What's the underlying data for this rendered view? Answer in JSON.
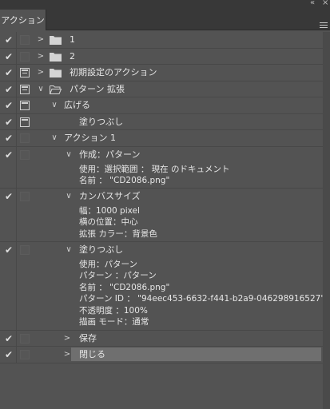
{
  "window": {
    "collapse_glyph": "«",
    "close_glyph": "×"
  },
  "panel": {
    "tab_label": "アクション"
  },
  "rows": [
    {
      "label": "1"
    },
    {
      "label": "2"
    },
    {
      "label": "初期設定のアクション"
    },
    {
      "label": "パターン 拡張"
    },
    {
      "label": "広げる"
    },
    {
      "label": "塗りつぶし"
    },
    {
      "label": "アクション 1"
    },
    {
      "label": "作成：パターン",
      "details": [
        "使用：選択範囲 ： 現在 のドキュメント",
        "名前 ： \"CD2086.png\""
      ]
    },
    {
      "label": "カンバスサイズ",
      "details": [
        "幅：1000 pixel",
        "横の位置：中心",
        "拡張 カラー：背景色"
      ]
    },
    {
      "label": "塗りつぶし",
      "details": [
        "使用：パターン",
        "パターン ：パターン",
        "名前 ： \"CD2086.png\"",
        "パターン ID ： \"94eec453-6632-f441-b2a9-046298916527\"",
        "不透明度 ：100%",
        "描画 モード：通常"
      ]
    },
    {
      "label": "保存"
    },
    {
      "label": "閉じる"
    }
  ],
  "icons": {
    "check": "checkmark-icon",
    "twisty_right": "chevron-right-icon",
    "twisty_down": "chevron-down-icon",
    "folder": "folder-icon",
    "dialog": "dialog-toggle-icon"
  },
  "colors": {
    "panel_bg": "#535353",
    "header_bg": "#383838",
    "selected_row": "#6f6f6f"
  }
}
